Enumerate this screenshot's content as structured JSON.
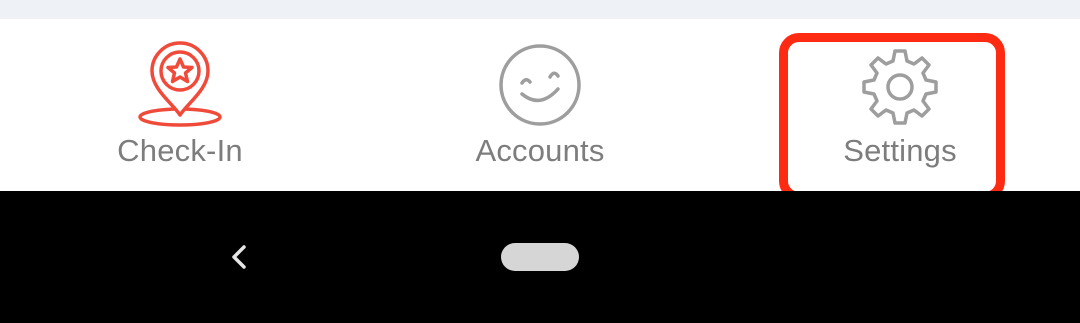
{
  "tabs": [
    {
      "label": "Check-In",
      "icon": "location-star-icon",
      "color": "#f04a3a",
      "selected": true
    },
    {
      "label": "Accounts",
      "icon": "smiley-face-icon",
      "color": "#9e9e9e",
      "selected": false
    },
    {
      "label": "Settings",
      "icon": "gear-icon",
      "color": "#9e9e9e",
      "selected": false
    }
  ],
  "highlight": {
    "target": "Settings",
    "color": "#ff2a12"
  },
  "system_nav": {
    "back_icon": "chevron-left-icon",
    "home_icon": "home-pill-icon",
    "background": "#000000"
  }
}
